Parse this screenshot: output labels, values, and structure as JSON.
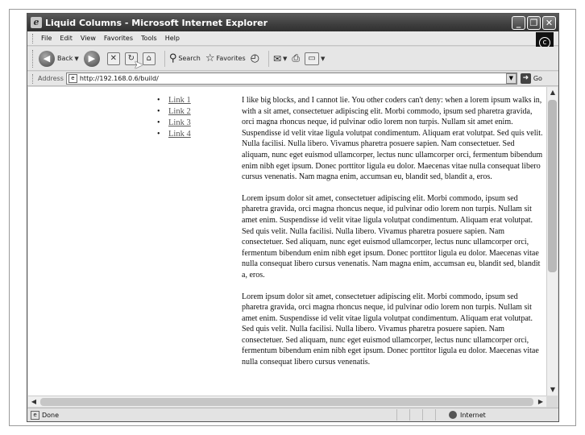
{
  "window": {
    "title": "Liquid Columns - Microsoft Internet Explorer",
    "minimize": "_",
    "maximize": "❐",
    "close": "✕"
  },
  "menu": {
    "items": [
      "File",
      "Edit",
      "View",
      "Favorites",
      "Tools",
      "Help"
    ]
  },
  "toolbar": {
    "back_label": "Back",
    "search_label": "Search",
    "favorites_label": "Favorites"
  },
  "address": {
    "label": "Address",
    "url": "http://192.168.0.6/build/",
    "go_label": "Go"
  },
  "nav": {
    "links": [
      "Link 1",
      "Link 2",
      "Link 3",
      "Link 4"
    ]
  },
  "content": {
    "paragraphs": [
      "I like big blocks, and I cannot lie. You other coders can't deny: when a lorem ipsum walks in, with a sit amet, consectetuer adipiscing elit. Morbi commodo, ipsum sed pharetra gravida, orci magna rhoncus neque, id pulvinar odio lorem non turpis. Nullam sit amet enim. Suspendisse id velit vitae ligula volutpat condimentum. Aliquam erat volutpat. Sed quis velit. Nulla facilisi. Nulla libero. Vivamus pharetra posuere sapien. Nam consectetuer. Sed aliquam, nunc eget euismod ullamcorper, lectus nunc ullamcorper orci, fermentum bibendum enim nibh eget ipsum. Donec porttitor ligula eu dolor. Maecenas vitae nulla consequat libero cursus venenatis. Nam magna enim, accumsan eu, blandit sed, blandit a, eros.",
      "Lorem ipsum dolor sit amet, consectetuer adipiscing elit. Morbi commodo, ipsum sed pharetra gravida, orci magna rhoncus neque, id pulvinar odio lorem non turpis. Nullam sit amet enim. Suspendisse id velit vitae ligula volutpat condimentum. Aliquam erat volutpat. Sed quis velit. Nulla facilisi. Nulla libero. Vivamus pharetra posuere sapien. Nam consectetuer. Sed aliquam, nunc eget euismod ullamcorper, lectus nunc ullamcorper orci, fermentum bibendum enim nibh eget ipsum. Donec porttitor ligula eu dolor. Maecenas vitae nulla consequat libero cursus venenatis. Nam magna enim, accumsan eu, blandit sed, blandit a, eros.",
      "Lorem ipsum dolor sit amet, consectetuer adipiscing elit. Morbi commodo, ipsum sed pharetra gravida, orci magna rhoncus neque, id pulvinar odio lorem non turpis. Nullam sit amet enim. Suspendisse id velit vitae ligula volutpat condimentum. Aliquam erat volutpat. Sed quis velit. Nulla facilisi. Nulla libero. Vivamus pharetra posuere sapien. Nam consectetuer. Sed aliquam, nunc eget euismod ullamcorper, lectus nunc ullamcorper orci, fermentum bibendum enim nibh eget ipsum. Donec porttitor ligula eu dolor. Maecenas vitae nulla consequat libero cursus venenatis."
    ]
  },
  "status": {
    "text": "Done",
    "zone": "Internet"
  },
  "colors": {
    "titlebar": "#3e3e3e",
    "link": "#555555"
  }
}
